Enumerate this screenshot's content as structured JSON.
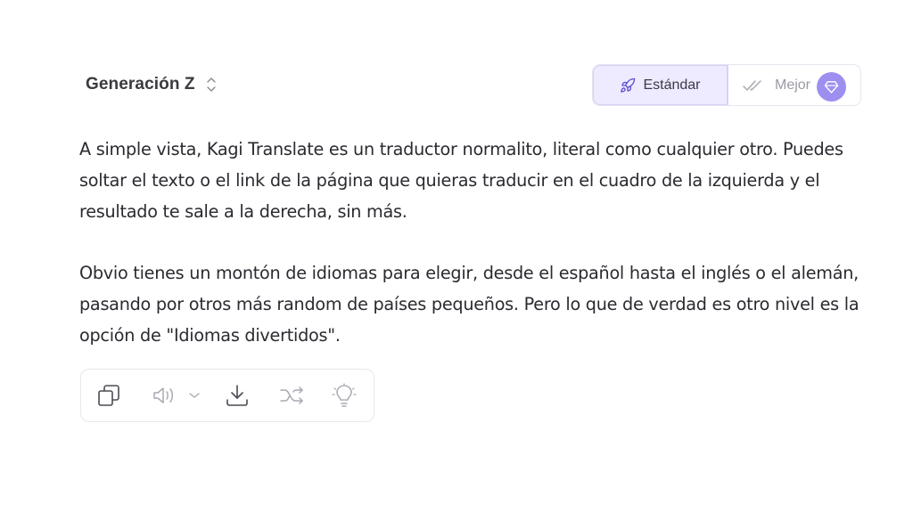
{
  "language_selector": {
    "label": "Generación Z"
  },
  "mode_toggle": {
    "standard_label": "Estándar",
    "better_label": "Mejor",
    "active": "standard"
  },
  "translation": {
    "paragraphs": [
      "A simple vista, Kagi Translate es un traductor normalito, literal como cualquier otro. Puedes soltar el texto o el link de la página que quieras traducir en el cuadro de la izquierda y el resultado te sale a la derecha, sin más.",
      "Obvio tienes un montón de idiomas para elegir, desde el español hasta el inglés o el alemán, pasando por otros más random de países pequeños. Pero lo que de verdad es otro nivel es la opción de \"Idiomas divertidos\"."
    ]
  },
  "toolbar": {
    "icons": [
      "copy-icon",
      "speaker-icon",
      "chevron-down-icon",
      "download-icon",
      "shuffle-icon",
      "lightbulb-icon"
    ]
  },
  "colors": {
    "accent": "#9d8ff0",
    "accent_bg": "#eeeaff",
    "icon_gray": "#9a9aa4"
  }
}
